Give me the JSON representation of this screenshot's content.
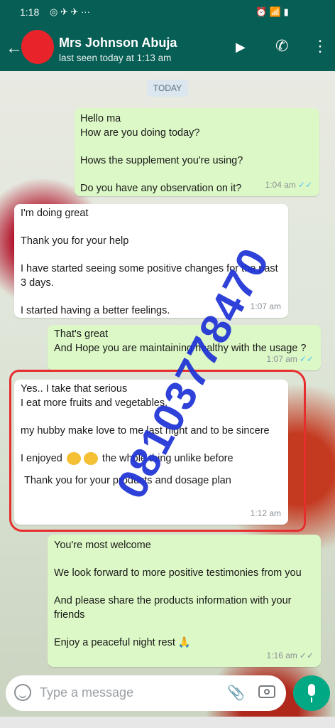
{
  "status_bar": {
    "time": "1:18",
    "left_icons": "◎ ✈ ✈ ···",
    "right_icons": "⏰ 📶 ▮"
  },
  "header": {
    "back_icon": "arrow-left-icon",
    "contact_name": "Mrs Johnson Abuja",
    "last_seen": "last seen today at 1:13 am",
    "video_icon": "▶",
    "call_icon": "✆",
    "menu_icon": "⋮"
  },
  "date_chip": "TODAY",
  "messages": [
    {
      "dir": "out",
      "text": "Hello ma\nHow are you doing today?\n\nHows the supplement you're using?\n\nDo you have any observation on it?",
      "time": "1:04 am",
      "tick": "✓✓"
    },
    {
      "dir": "in",
      "text": "I'm doing great\n\nThank you for your help\n\nI have started seeing some positive changes for the past 3 days.\n\nI started having a better feelings.",
      "time": "1:07 am"
    },
    {
      "dir": "out",
      "text": "That's great\nAnd Hope you are maintaining healthy with the usage ?",
      "time": "1:07 am",
      "tick": "✓✓"
    },
    {
      "dir": "in",
      "text_a": "Yes.. I take that serious\nI eat more fruits and vegetables.\n\nmy hubby make love to me last night and to be sincere\n\nI enjoyed",
      "text_b": "the whole thing unlike before",
      "text_c": "Thank you for your products and dosage plan",
      "time": "1:12 am"
    },
    {
      "dir": "out",
      "text": "You're most welcome\n\nWe look forward to more positive testimonies from you\n\nAnd please share the products information with your friends\n\nEnjoy a peaceful night rest 🙏",
      "time": "1:16 am",
      "tick": "✓✓"
    }
  ],
  "watermark": "08103778470",
  "input": {
    "placeholder": "Type a message",
    "attach_icon": "📎"
  }
}
